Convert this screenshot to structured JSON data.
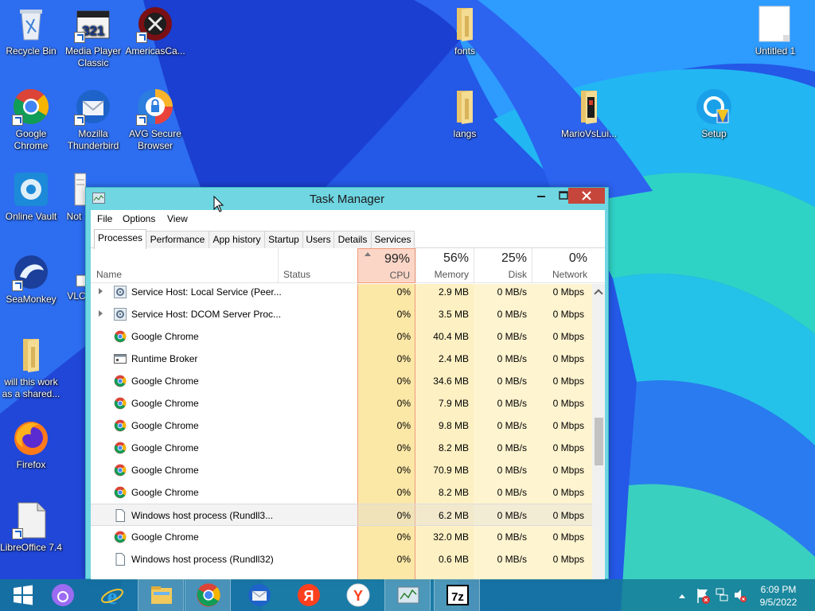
{
  "desktop": {
    "icons": [
      {
        "label": "Recycle Bin",
        "icon": "recycle-bin-icon"
      },
      {
        "label": "Media Player Classic",
        "icon": "media-player-classic-icon"
      },
      {
        "label": "AmericasCa...",
        "icon": "americas-cardroom-icon"
      },
      {
        "label": "fonts",
        "icon": "folder-icon"
      },
      {
        "label": "Untitled 1",
        "icon": "document-icon"
      },
      {
        "label": "Google Chrome",
        "icon": "chrome-icon"
      },
      {
        "label": "Mozilla Thunderbird",
        "icon": "thunderbird-icon"
      },
      {
        "label": "AVG Secure Browser",
        "icon": "avg-browser-icon"
      },
      {
        "label": "langs",
        "icon": "folder-icon"
      },
      {
        "label": "MarioVsLui...",
        "icon": "folder-icon"
      },
      {
        "label": "Setup",
        "icon": "setup-icon"
      },
      {
        "label": "Online Vault",
        "icon": "online-vault-icon"
      },
      {
        "label": "Not",
        "icon": "notepad-icon"
      },
      {
        "label": "SeaMonkey",
        "icon": "seamonkey-icon"
      },
      {
        "label": "VLC",
        "icon": "vlc-icon"
      },
      {
        "label": "will this work as a shared...",
        "icon": "folder-icon"
      },
      {
        "label": "Firefox",
        "icon": "firefox-icon"
      },
      {
        "label": "LibreOffice 7.4",
        "icon": "libreoffice-icon"
      }
    ]
  },
  "task_manager": {
    "title": "Task Manager",
    "menu": [
      "File",
      "Options",
      "View"
    ],
    "tabs": [
      "Processes",
      "Performance",
      "App history",
      "Startup",
      "Users",
      "Details",
      "Services"
    ],
    "active_tab": "Processes",
    "columns": {
      "name": "Name",
      "status": "Status",
      "cpu": {
        "percent": "99%",
        "label": "CPU"
      },
      "memory": {
        "percent": "56%",
        "label": "Memory"
      },
      "disk": {
        "percent": "25%",
        "label": "Disk"
      },
      "network": {
        "percent": "0%",
        "label": "Network"
      }
    },
    "rows": [
      {
        "name": "Service Host: Local Service (Peer...",
        "icon": "gear-icon",
        "expandable": true,
        "cpu": "0%",
        "memory": "2.9 MB",
        "disk": "0 MB/s",
        "network": "0 Mbps"
      },
      {
        "name": "Service Host: DCOM Server Proc...",
        "icon": "gear-icon",
        "expandable": true,
        "cpu": "0%",
        "memory": "3.5 MB",
        "disk": "0 MB/s",
        "network": "0 Mbps"
      },
      {
        "name": "Google Chrome",
        "icon": "chrome-icon",
        "expandable": false,
        "cpu": "0%",
        "memory": "40.4 MB",
        "disk": "0 MB/s",
        "network": "0 Mbps"
      },
      {
        "name": "Runtime Broker",
        "icon": "window-icon",
        "expandable": false,
        "cpu": "0%",
        "memory": "2.4 MB",
        "disk": "0 MB/s",
        "network": "0 Mbps"
      },
      {
        "name": "Google Chrome",
        "icon": "chrome-icon",
        "expandable": false,
        "cpu": "0%",
        "memory": "34.6 MB",
        "disk": "0 MB/s",
        "network": "0 Mbps"
      },
      {
        "name": "Google Chrome",
        "icon": "chrome-icon",
        "expandable": false,
        "cpu": "0%",
        "memory": "7.9 MB",
        "disk": "0 MB/s",
        "network": "0 Mbps"
      },
      {
        "name": "Google Chrome",
        "icon": "chrome-icon",
        "expandable": false,
        "cpu": "0%",
        "memory": "9.8 MB",
        "disk": "0 MB/s",
        "network": "0 Mbps"
      },
      {
        "name": "Google Chrome",
        "icon": "chrome-icon",
        "expandable": false,
        "cpu": "0%",
        "memory": "8.2 MB",
        "disk": "0 MB/s",
        "network": "0 Mbps"
      },
      {
        "name": "Google Chrome",
        "icon": "chrome-icon",
        "expandable": false,
        "cpu": "0%",
        "memory": "70.9 MB",
        "disk": "0 MB/s",
        "network": "0 Mbps"
      },
      {
        "name": "Google Chrome",
        "icon": "chrome-icon",
        "expandable": false,
        "cpu": "0%",
        "memory": "8.2 MB",
        "disk": "0 MB/s",
        "network": "0 Mbps"
      },
      {
        "name": "Windows host process (Rundll3...",
        "icon": "file-icon",
        "expandable": false,
        "cpu": "0%",
        "memory": "6.2 MB",
        "disk": "0 MB/s",
        "network": "0 Mbps"
      },
      {
        "name": "Google Chrome",
        "icon": "chrome-icon",
        "expandable": false,
        "cpu": "0%",
        "memory": "32.0 MB",
        "disk": "0 MB/s",
        "network": "0 Mbps"
      },
      {
        "name": "Windows host process (Rundll32)",
        "icon": "file-icon",
        "expandable": false,
        "cpu": "0%",
        "memory": "0.6 MB",
        "disk": "0 MB/s",
        "network": "0 Mbps"
      }
    ]
  },
  "taskbar": {
    "items": [
      "start-icon",
      "cortana-icon",
      "internet-explorer-icon",
      "file-explorer-icon",
      "chrome-icon",
      "thunderbird-icon",
      "yandex-icon",
      "yandex-browser-icon",
      "task-manager-icon",
      "7zip-icon"
    ],
    "clock_time": "6:09 PM",
    "clock_date": "9/5/2022"
  }
}
